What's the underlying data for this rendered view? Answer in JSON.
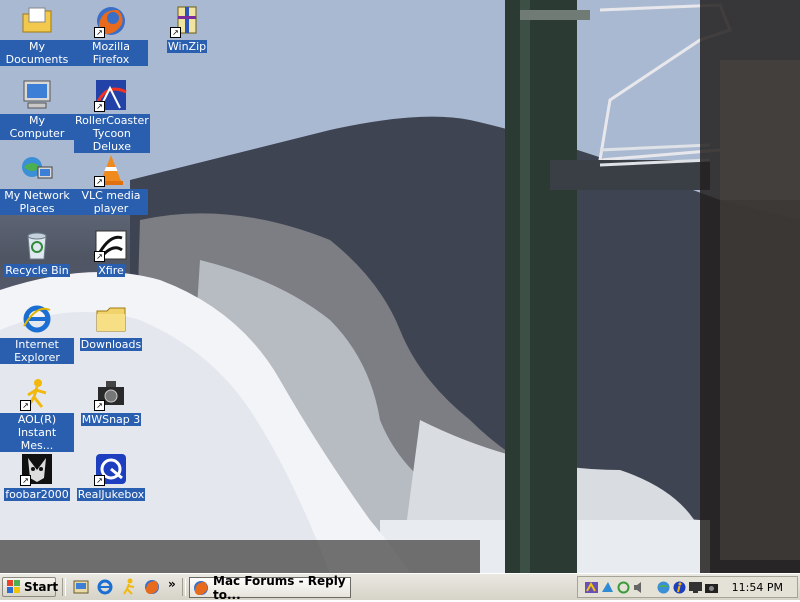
{
  "desktop": {
    "icons": [
      {
        "label": "My Documents",
        "icon": "folder-documents-icon",
        "shortcut": false
      },
      {
        "label": "Mozilla Firefox",
        "icon": "firefox-icon",
        "shortcut": true
      },
      {
        "label": "WinZip",
        "icon": "winzip-icon",
        "shortcut": true
      },
      {
        "label": "My Computer",
        "icon": "computer-icon",
        "shortcut": false
      },
      {
        "label": "RollerCoaster Tycoon Deluxe",
        "icon": "rollercoaster-icon",
        "shortcut": true
      },
      {
        "label": "My Network Places",
        "icon": "network-icon",
        "shortcut": false
      },
      {
        "label": "VLC media player",
        "icon": "vlc-cone-icon",
        "shortcut": true
      },
      {
        "label": "Recycle Bin",
        "icon": "recycle-bin-icon",
        "shortcut": false
      },
      {
        "label": "Xfire",
        "icon": "xfire-icon",
        "shortcut": true
      },
      {
        "label": "Internet Explorer",
        "icon": "internet-explorer-icon",
        "shortcut": false
      },
      {
        "label": "Downloads",
        "icon": "folder-icon",
        "shortcut": false
      },
      {
        "label": "AOL(R) Instant Mes...",
        "icon": "aim-icon",
        "shortcut": true
      },
      {
        "label": "MWSnap 3",
        "icon": "camera-icon",
        "shortcut": true
      },
      {
        "label": "foobar2000",
        "icon": "foobar-icon",
        "shortcut": true
      },
      {
        "label": "RealJukebox",
        "icon": "realjukebox-icon",
        "shortcut": true
      }
    ]
  },
  "taskbar": {
    "start_label": "Start",
    "quick_launch": [
      "show-desktop-icon",
      "internet-explorer-icon",
      "aim-icon",
      "firefox-icon"
    ],
    "more_label": "»",
    "task_title": "Mac Forums - Reply to...",
    "tray_icons": [
      "tray-app-icon",
      "tray-bird-icon",
      "tray-sync-icon",
      "tray-volume-icon",
      "tray-network-icon",
      "tray-aim-icon",
      "tray-display-icon",
      "tray-camera-icon"
    ],
    "clock": "11:54 PM"
  },
  "colors": {
    "label_bg": "#2a5fb0",
    "taskbar_bg": "#d6d3c8"
  }
}
